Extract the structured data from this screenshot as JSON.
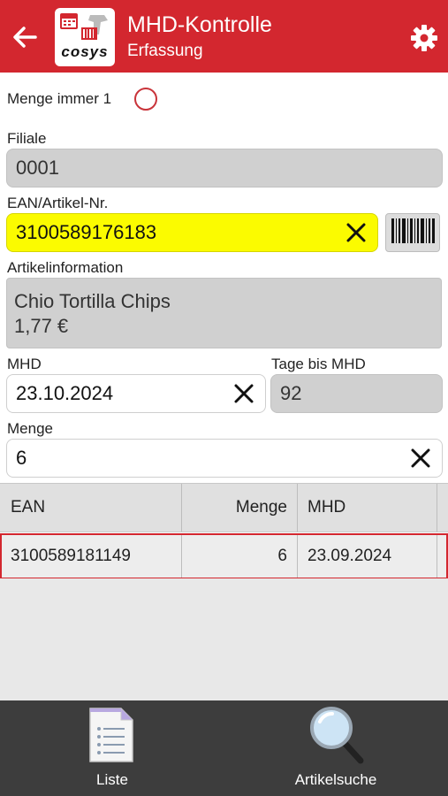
{
  "header": {
    "title": "MHD-Kontrolle",
    "subtitle": "Erfassung",
    "logo_text": "cosys"
  },
  "form": {
    "menge_immer_1_label": "Menge immer 1",
    "filiale_label": "Filiale",
    "filiale_value": "0001",
    "ean_label": "EAN/Artikel-Nr.",
    "ean_value": "3100589176183",
    "artikelinfo_label": "Artikelinformation",
    "artikel_name": "Chio Tortilla Chips",
    "artikel_preis": "1,77 €",
    "mhd_label": "MHD",
    "mhd_value": "23.10.2024",
    "tage_label": "Tage bis MHD",
    "tage_value": "92",
    "menge_label": "Menge",
    "menge_value": "6"
  },
  "table": {
    "columns": [
      "EAN",
      "Menge",
      "MHD"
    ],
    "rows": [
      {
        "ean": "3100589181149",
        "menge": "6",
        "mhd": "23.09.2024"
      }
    ]
  },
  "bottom_nav": {
    "liste_label": "Liste",
    "artikelsuche_label": "Artikelsuche"
  },
  "colors": {
    "header_red": "#d3272f",
    "ean_highlight": "#fbfb00",
    "bottom_bar": "#3d3d3d"
  },
  "icons": [
    "back-arrow-icon",
    "app-logo-icon",
    "gear-icon",
    "barcode-icon",
    "close-icon",
    "list-document-icon",
    "magnifier-icon"
  ]
}
